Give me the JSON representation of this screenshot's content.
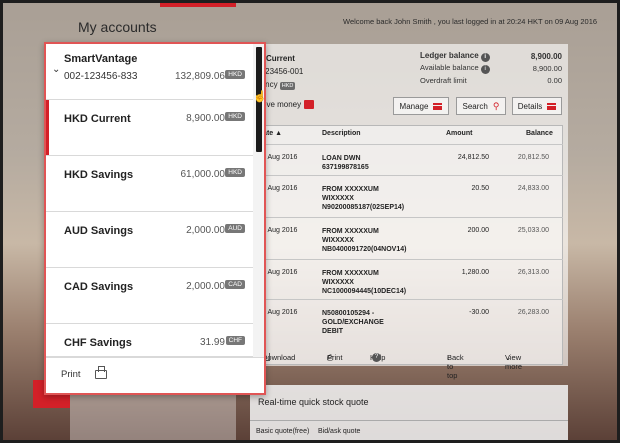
{
  "header": {
    "title": "My accounts",
    "welcome": "Welcome back John Smith , you last logged in at 20:24 HKT on 09 Aug 2016"
  },
  "account_details": {
    "name_partial": "D Current",
    "number_partial": "-123456-001",
    "currency_label_partial": "rency",
    "currency": "HKD",
    "ledger_label": "Ledger balance",
    "ledger_value": "8,900.00",
    "available_label": "Available balance",
    "available_value": "8,900.00",
    "overdraft_label": "Overdraft limit",
    "overdraft_value": "0.00"
  },
  "actions": {
    "move_money": "ove money",
    "manage": "Manage",
    "search": "Search",
    "details": "Details"
  },
  "table": {
    "headers": {
      "date": "Date",
      "description": "Description",
      "amount": "Amount",
      "balance": "Balance"
    },
    "rows": [
      {
        "date": "9 Aug 2016",
        "desc1": "LOAN DWN",
        "desc2": "637199878165",
        "desc3": "",
        "amount": "24,812.50",
        "balance": "20,812.50"
      },
      {
        "date": "9 Aug 2016",
        "desc1": "FROM XXXXXUM",
        "desc2": "WIXXXXX",
        "desc3": "N90200085187(02SEP14)",
        "amount": "20.50",
        "balance": "24,833.00"
      },
      {
        "date": "9 Aug 2016",
        "desc1": "FROM XXXXXUM",
        "desc2": "WIXXXXX",
        "desc3": "NB0400091720(04NOV14)",
        "amount": "200.00",
        "balance": "25,033.00"
      },
      {
        "date": "9 Aug 2016",
        "desc1": "FROM XXXXXUM",
        "desc2": "WIXXXXX",
        "desc3": "NC1000094445(10DEC14)",
        "amount": "1,280.00",
        "balance": "26,313.00"
      },
      {
        "date": "9 Aug 2016",
        "desc1": "N50800105294 -",
        "desc2": "GOLD/EXCHANGE",
        "desc3": "DEBIT",
        "amount": "-30.00",
        "balance": "26,283.00"
      }
    ],
    "footer": {
      "download": "Download",
      "print": "Print",
      "help": "Help",
      "back_to_top": "Back to top",
      "view_more": "View more"
    }
  },
  "stock": {
    "title": "Real-time quick stock quote",
    "tab_basic": "Basic quote(free)",
    "tab_bidask": "Bid/ask quote"
  },
  "dropdown": {
    "first": {
      "name": "SmartVantage",
      "account_no": "002-123456-833",
      "amount": "132,809.06",
      "currency": "HKD"
    },
    "items": [
      {
        "name": "HKD Current",
        "amount": "8,900.00",
        "currency": "HKD"
      },
      {
        "name": "HKD Savings",
        "amount": "61,000.00",
        "currency": "HKD"
      },
      {
        "name": "AUD Savings",
        "amount": "2,000.00",
        "currency": "AUD"
      },
      {
        "name": "CAD Savings",
        "amount": "2,000.00",
        "currency": "CAD"
      },
      {
        "name": "CHF Savings",
        "amount": "31.99",
        "currency": "CHF"
      }
    ],
    "print": "Print"
  },
  "colors": {
    "accent": "#d32028",
    "highlight_border": "#e05555"
  }
}
